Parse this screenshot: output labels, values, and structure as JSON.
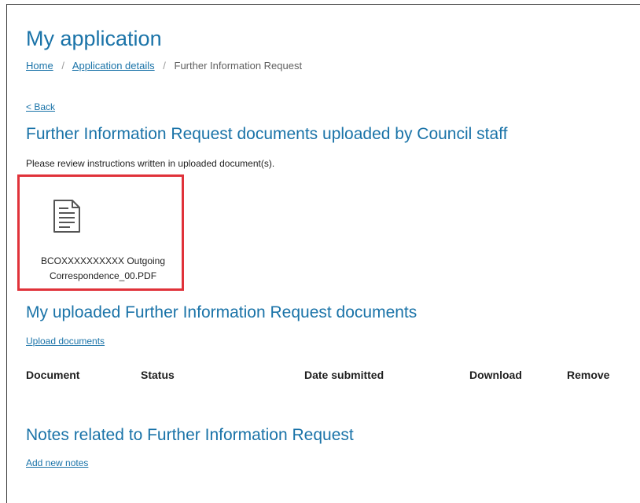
{
  "header": {
    "title": "My application",
    "breadcrumb": [
      {
        "label": "Home"
      },
      {
        "label": "Application details"
      },
      {
        "label": "Further Information Request"
      }
    ]
  },
  "back_link": "< Back",
  "council_docs": {
    "heading": "Further Information Request documents uploaded by Council staff",
    "instructions": "Please review instructions written in uploaded document(s).",
    "document": {
      "name_line1": "BCOXXXXXXXXXX Outgoing",
      "name_line2": "Correspondence_00.PDF",
      "icon": "document-icon"
    }
  },
  "my_docs": {
    "heading": "My uploaded Further Information Request documents",
    "upload_link": "Upload documents",
    "columns": [
      "Document",
      "Status",
      "Date submitted",
      "Download",
      "Remove"
    ]
  },
  "notes": {
    "heading": "Notes related to Further Information Request",
    "add_link": "Add new notes"
  },
  "colors": {
    "accent": "#1a73a8",
    "highlight": "#e0323a"
  }
}
